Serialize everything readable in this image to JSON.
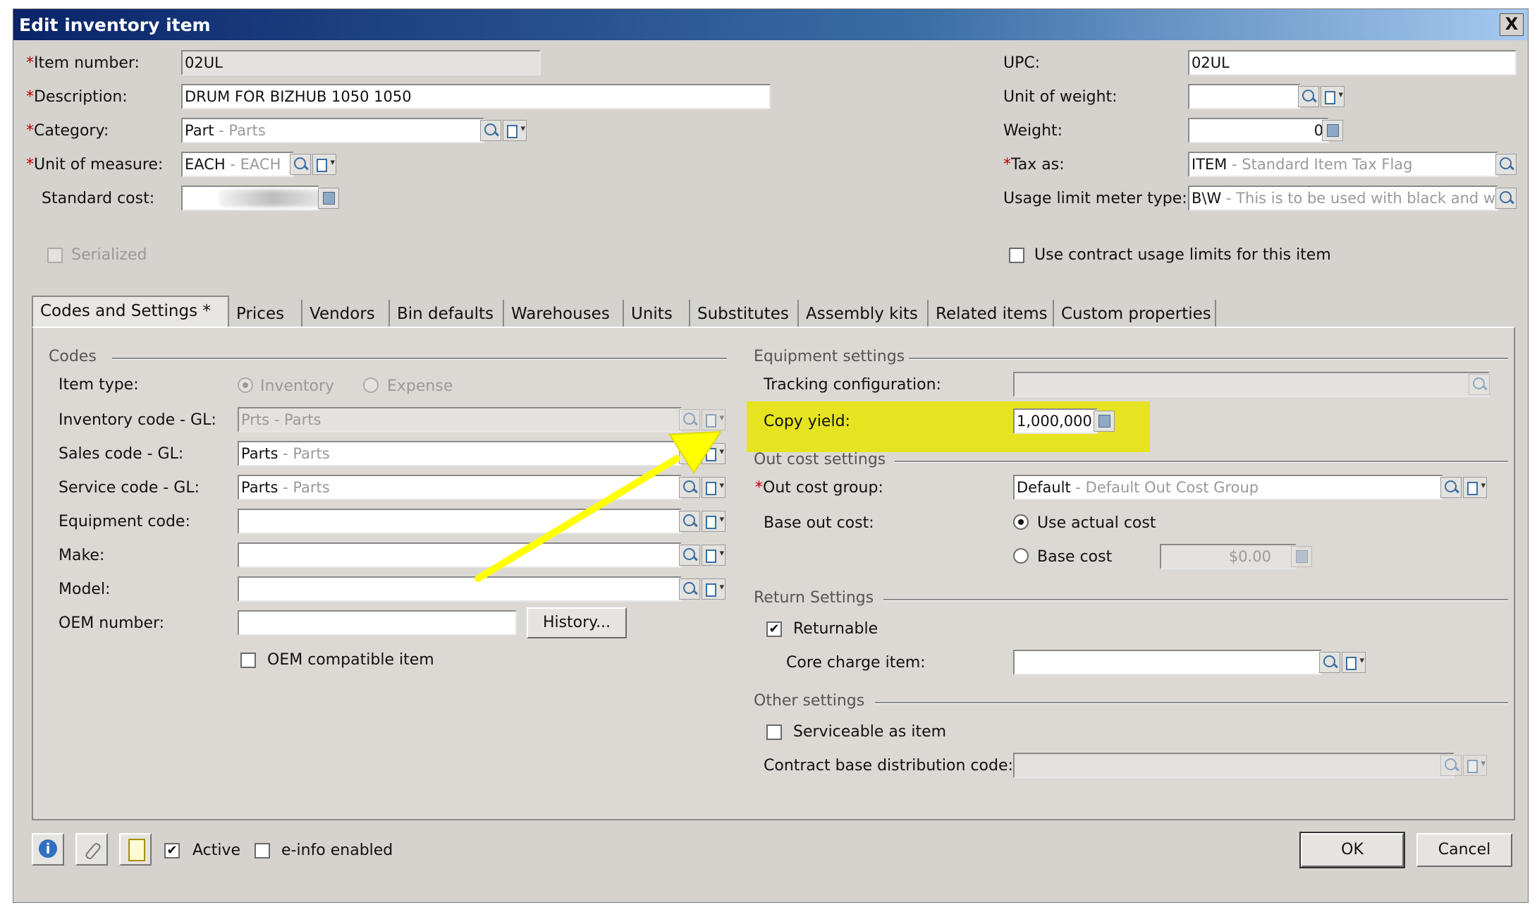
{
  "window": {
    "title": "Edit inventory item",
    "close_label": "X"
  },
  "left_fields": {
    "item_number": {
      "label": "Item number:",
      "required": "*",
      "value": "02UL"
    },
    "description": {
      "label": "Description:",
      "required": "*",
      "value": "DRUM FOR BIZHUB 1050 1050"
    },
    "category": {
      "label": "Category:",
      "required": "*",
      "value": "Part",
      "sub": " - Parts"
    },
    "unit_of_measure": {
      "label": "Unit of measure:",
      "required": "*",
      "value": "EACH",
      "sub": " - EACH"
    },
    "standard_cost": {
      "label": "Standard cost:"
    },
    "serialized": {
      "label": "Serialized"
    }
  },
  "right_fields": {
    "upc": {
      "label": "UPC:",
      "value": "02UL"
    },
    "unit_of_weight": {
      "label": "Unit of weight:"
    },
    "weight": {
      "label": "Weight:",
      "value": "0"
    },
    "tax_as": {
      "label": "Tax as:",
      "required": "*",
      "value": "ITEM",
      "sub": " - Standard Item Tax Flag"
    },
    "usage_limit": {
      "label": "Usage limit meter type:",
      "value": "B\\W",
      "sub": " - This is to be used with black and wh"
    },
    "use_contract": {
      "label": "Use contract usage limits for this item"
    }
  },
  "tabs": [
    {
      "label": "Codes and Settings *"
    },
    {
      "label": "Prices"
    },
    {
      "label": "Vendors"
    },
    {
      "label": "Bin defaults"
    },
    {
      "label": "Warehouses"
    },
    {
      "label": "Units"
    },
    {
      "label": "Substitutes"
    },
    {
      "label": "Assembly kits"
    },
    {
      "label": "Related items"
    },
    {
      "label": "Custom properties"
    }
  ],
  "codes": {
    "group": "Codes",
    "item_type": {
      "label": "Item type:",
      "opt1": "Inventory",
      "opt2": "Expense"
    },
    "inventory_code": {
      "label": "Inventory code - GL:",
      "value": "Prts",
      "sub": " - Parts"
    },
    "sales_code": {
      "label": "Sales code - GL:",
      "value": "Parts",
      "sub": " - Parts"
    },
    "service_code": {
      "label": "Service code - GL:",
      "value": "Parts",
      "sub": " - Parts"
    },
    "equipment_code": {
      "label": "Equipment code:"
    },
    "make": {
      "label": "Make:"
    },
    "model": {
      "label": "Model:"
    },
    "oem_number": {
      "label": "OEM number:",
      "history_button": "History..."
    },
    "oem_compatible": {
      "label": "OEM compatible item"
    }
  },
  "equipment": {
    "group": "Equipment settings",
    "tracking": {
      "label": "Tracking configuration:"
    },
    "copy_yield": {
      "label": "Copy yield:",
      "value": "1,000,000"
    }
  },
  "out_cost": {
    "group": "Out cost settings",
    "group_field": {
      "label": "Out cost group:",
      "required": "*",
      "value": "Default",
      "sub": " - Default Out Cost Group"
    },
    "base": {
      "label": "Base out cost:",
      "actual": "Use actual cost",
      "base": "Base cost",
      "base_value": "$0.00"
    }
  },
  "return": {
    "group": "Return Settings",
    "returnable": {
      "label": "Returnable",
      "check": "✔"
    },
    "core_charge": {
      "label": "Core charge item:"
    }
  },
  "other": {
    "group": "Other settings",
    "serviceable": {
      "label": "Serviceable as item"
    },
    "contract_base": {
      "label": "Contract base distribution code:"
    }
  },
  "footer": {
    "active": {
      "label": "Active",
      "check": "✔"
    },
    "einfo": {
      "label": "e-info enabled"
    },
    "ok": "OK",
    "cancel": "Cancel",
    "info_icon": "i"
  },
  "colors": {
    "highlight": "#e8e400",
    "arrow": "#ffff00",
    "titlebar": "#0a246a"
  }
}
